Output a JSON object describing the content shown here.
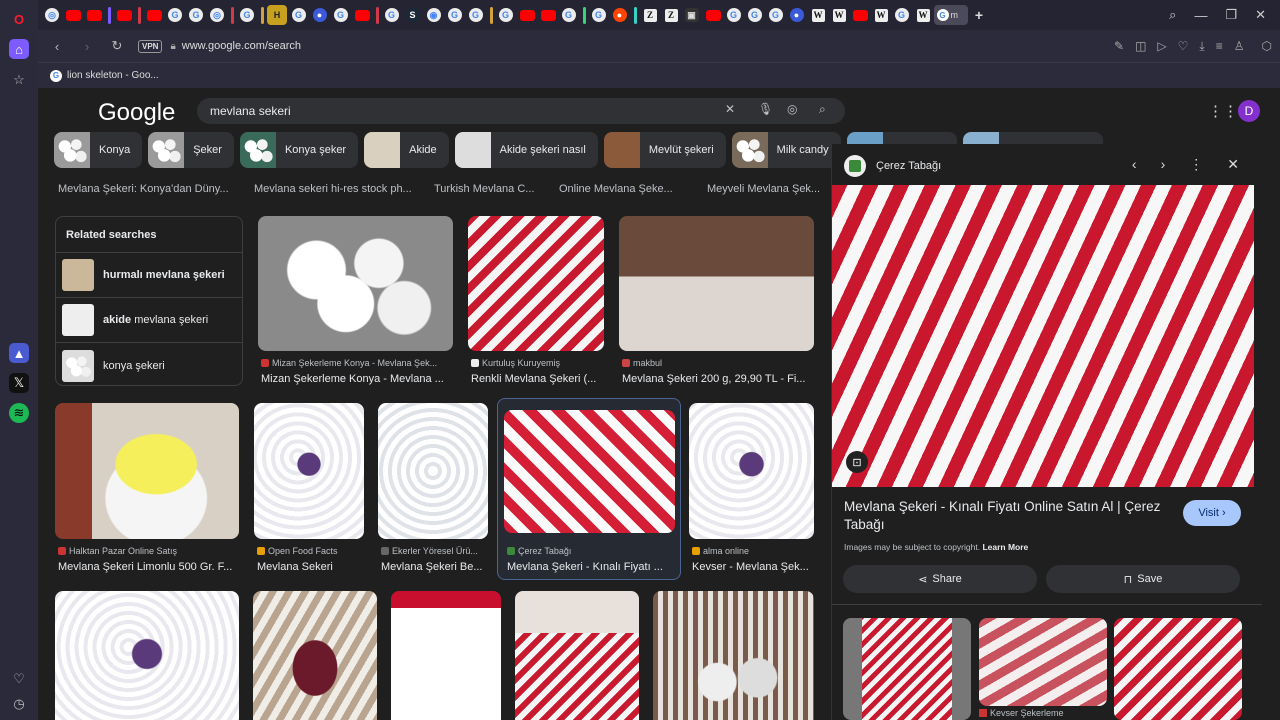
{
  "browser": {
    "url": "www.google.com/search",
    "vpn_label": "VPN",
    "bookmark": "lion skeleton - Goo...",
    "active_tab_label": "m"
  },
  "google": {
    "logo": "Google",
    "query": "mevlana sekeri",
    "avatar_letter": "D",
    "chips": [
      {
        "label": "Konya"
      },
      {
        "label": "Şeker"
      },
      {
        "label": "Konya şeker"
      },
      {
        "label": "Akide"
      },
      {
        "label": "Akide şekeri nasıl"
      },
      {
        "label": "Mevlüt şekeri"
      },
      {
        "label": "Milk candy"
      }
    ],
    "top_captions": [
      "Mevlana Şekeri: Konya'dan Düny...",
      "Mevlana sekeri hi-res stock ph...",
      "Turkish Mevlana C...",
      "Online Mevlana Şeke...",
      "Meyveli Mevlana Şek..."
    ],
    "related": {
      "heading": "Related searches",
      "items": [
        {
          "bold": "hurmalı",
          "rest": "mevlana şekeri"
        },
        {
          "bold": "akide",
          "rest": "mevlana şekeri"
        },
        {
          "bold": "",
          "rest": "konya şekeri"
        }
      ]
    },
    "results": [
      {
        "source": "Mizan Şekerleme Konya - Mevlana Şek...",
        "title": "Mizan Şekerleme Konya - Mevlana ..."
      },
      {
        "source": "Kurtuluş Kuruyemiş",
        "title": "Renkli Mevlana Şekeri (..."
      },
      {
        "source": "makbul",
        "title": "Mevlana Şekeri 200 g, 29,90 TL - Fi..."
      },
      {
        "source": "Halktan Pazar Online Satış",
        "title": "Mevlana Şekeri Limonlu 500 Gr. F..."
      },
      {
        "source": "Open Food Facts",
        "title": "Mevlana Sekeri"
      },
      {
        "source": "Ekerler Yöresel Ürü...",
        "title": "Mevlana Şekeri Be..."
      },
      {
        "source": "Çerez Tabağı",
        "title": "Mevlana Şekeri - Kınalı Fiyatı ..."
      },
      {
        "source": "alma online",
        "title": "Kevser - Mevlana Şek..."
      }
    ]
  },
  "panel": {
    "site": "Çerez Tabağı",
    "title": "Mevlana Şekeri - Kınalı Fiyatı Online Satın Al | Çerez Tabağı",
    "visit": "Visit",
    "copyright": "Images may be subject to copyright.",
    "learn_more": "Learn More",
    "share": "Share",
    "save": "Save",
    "thumb_caption": "Kevser Şekerleme"
  }
}
